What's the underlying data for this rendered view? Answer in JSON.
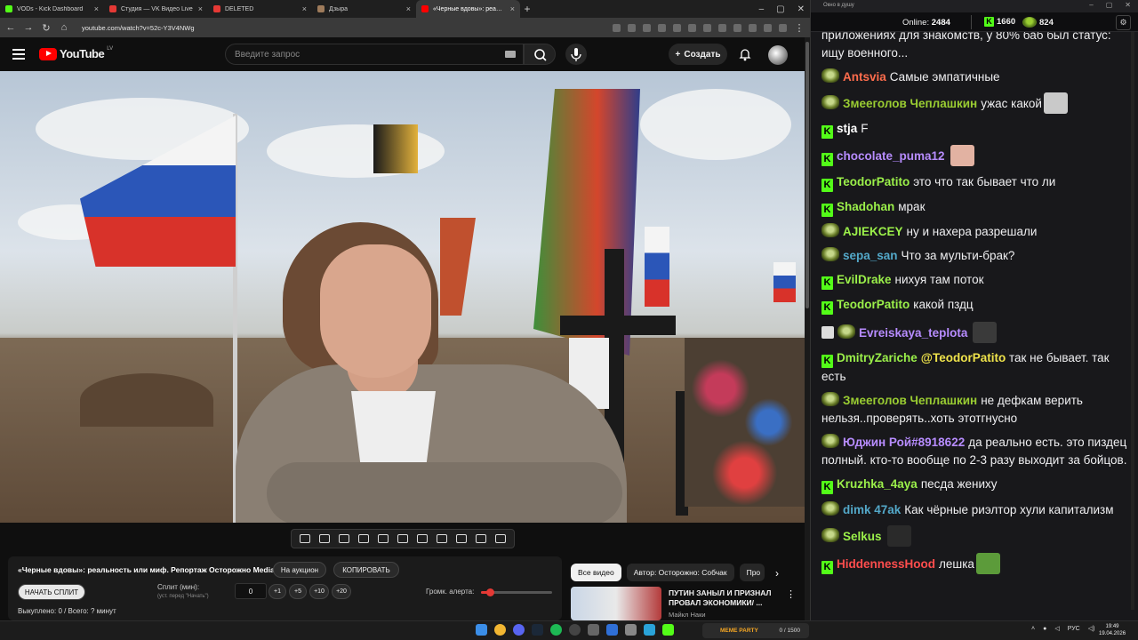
{
  "browser": {
    "tabs": [
      {
        "title": "VODs - Kick Dashboard",
        "color": "#53fc18"
      },
      {
        "title": "Студия — VK Видео Live",
        "color": "#e53935"
      },
      {
        "title": "DELETED",
        "color": "#e53935"
      },
      {
        "title": "Дзыра",
        "color": "#9e7b5b"
      },
      {
        "title": "«Черные вдовы»: реальн",
        "color": "#ff0000"
      }
    ],
    "url": "youtube.com/watch?v=52c-Y3V4NWg"
  },
  "youtube": {
    "logo": "YouTube",
    "country": "LV",
    "search_placeholder": "Введите запрос",
    "create_label": "Создать"
  },
  "panel": {
    "title": "«Черные вдовы»: реальность или миф. Репортаж Осторожно Media",
    "auction_btn": "На аукцион",
    "copy_btn": "КОПИРОВАТЬ",
    "start_split_btn": "НАЧАТЬ СПЛИТ",
    "split_label": "Сплит (мин):",
    "split_sub": "(уст. перед \"Начать\")",
    "split_value": "0",
    "increments": [
      "+1",
      "+5",
      "+10",
      "+20"
    ],
    "alert_volume_label": "Громк. алерта:",
    "alert_volume": 0.12,
    "spent": "Выкуплено: 0 / Всего: ? минут"
  },
  "recommendations": {
    "chips": [
      "Все видео",
      "Автор: Осторожно: Собчак",
      "Про"
    ],
    "video": {
      "title": "ПУТИН ЗАНЫЛ И ПРИЗНАЛ ПРОВАЛ ЭКОНОМИКИ/ ...",
      "channel": "Майкл Наки"
    }
  },
  "chat": {
    "window_title": "Окно в душу",
    "online_label": "Online:",
    "online_count": "2484",
    "kick_count": "1660",
    "other_count": "824",
    "messages": [
      {
        "badge": "",
        "user": "",
        "color": "#efeff1",
        "text": "приложениях для знакомств, у 80% баб был статус: ищу военного...",
        "emote": ""
      },
      {
        "badge": "p",
        "user": "Antsvia",
        "color": "#ff6d4d",
        "text": "Самые эмпатичные",
        "emote": ""
      },
      {
        "badge": "p",
        "user": "Змееголов Чеплашкин",
        "color": "#9acd32",
        "text": "ужас какой",
        "emote": "#c9c9c9"
      },
      {
        "badge": "k",
        "user": "stja",
        "color": "#ffffff",
        "text": "F",
        "emote": ""
      },
      {
        "badge": "k",
        "user": "chocolate_puma12",
        "color": "#b78cff",
        "text": "",
        "emote": "#e2b2a2"
      },
      {
        "badge": "k",
        "user": "TeodorPatito",
        "color": "#9bf04a",
        "text": "это что так бывает что ли",
        "emote": ""
      },
      {
        "badge": "k",
        "user": "Shadohan",
        "color": "#9bf04a",
        "text": "мрак",
        "emote": ""
      },
      {
        "badge": "p",
        "user": "AJIEKCEY",
        "color": "#9bf04a",
        "text": "ну и нахера разрешали",
        "emote": ""
      },
      {
        "badge": "p",
        "user": "sepa_san",
        "color": "#53a8c9",
        "text": "Что за мульти-брак?",
        "emote": ""
      },
      {
        "badge": "k",
        "user": "EvilDrake",
        "color": "#9bf04a",
        "text": "нихуя там поток",
        "emote": ""
      },
      {
        "badge": "k",
        "user": "TeodorPatito",
        "color": "#9bf04a",
        "text": "какой пздц",
        "emote": ""
      },
      {
        "badge": "pen",
        "user": "Evreiskaya_teplota",
        "color": "#b78cff",
        "text": "",
        "emote": "#3a3a3a"
      },
      {
        "badge": "k",
        "user": "DmitryZariche",
        "color": "#9bf04a",
        "mention": "@TeodorPatito",
        "text": "так не бывает. так есть",
        "emote": ""
      },
      {
        "badge": "p",
        "user": "Змееголов Чеплашкин",
        "color": "#9acd32",
        "text": "не дефкам верить нельзя..проверять..хоть этотгнусно",
        "emote": ""
      },
      {
        "badge": "p",
        "user": "Юджин Рой#8918622",
        "color": "#b78cff",
        "text": "да реально есть. это пиздец полный. кто-то вообще по 2-3 разу выходит за бойцов.",
        "emote": ""
      },
      {
        "badge": "k",
        "user": "Kruzhka_4aya",
        "color": "#9bf04a",
        "text": "песда жениху",
        "emote": ""
      },
      {
        "badge": "p",
        "user": "dimk 47ak",
        "color": "#53a8c9",
        "text": "Как чёрные риэлтор хули капитализм",
        "emote": ""
      },
      {
        "badge": "p",
        "user": "Selkus",
        "color": "#9bf04a",
        "text": "",
        "emote": "#2a2a2a"
      },
      {
        "badge": "k",
        "user": "HiddennessHood",
        "color": "#ff4d4d",
        "text": "лешка",
        "emote": "#5c9b3a"
      }
    ]
  },
  "taskbar": {
    "memes_label": "MEME PARTY",
    "memes_count": "0 / 1500",
    "lang": "РУС",
    "time": "19:49",
    "date": "19.04.2026"
  }
}
